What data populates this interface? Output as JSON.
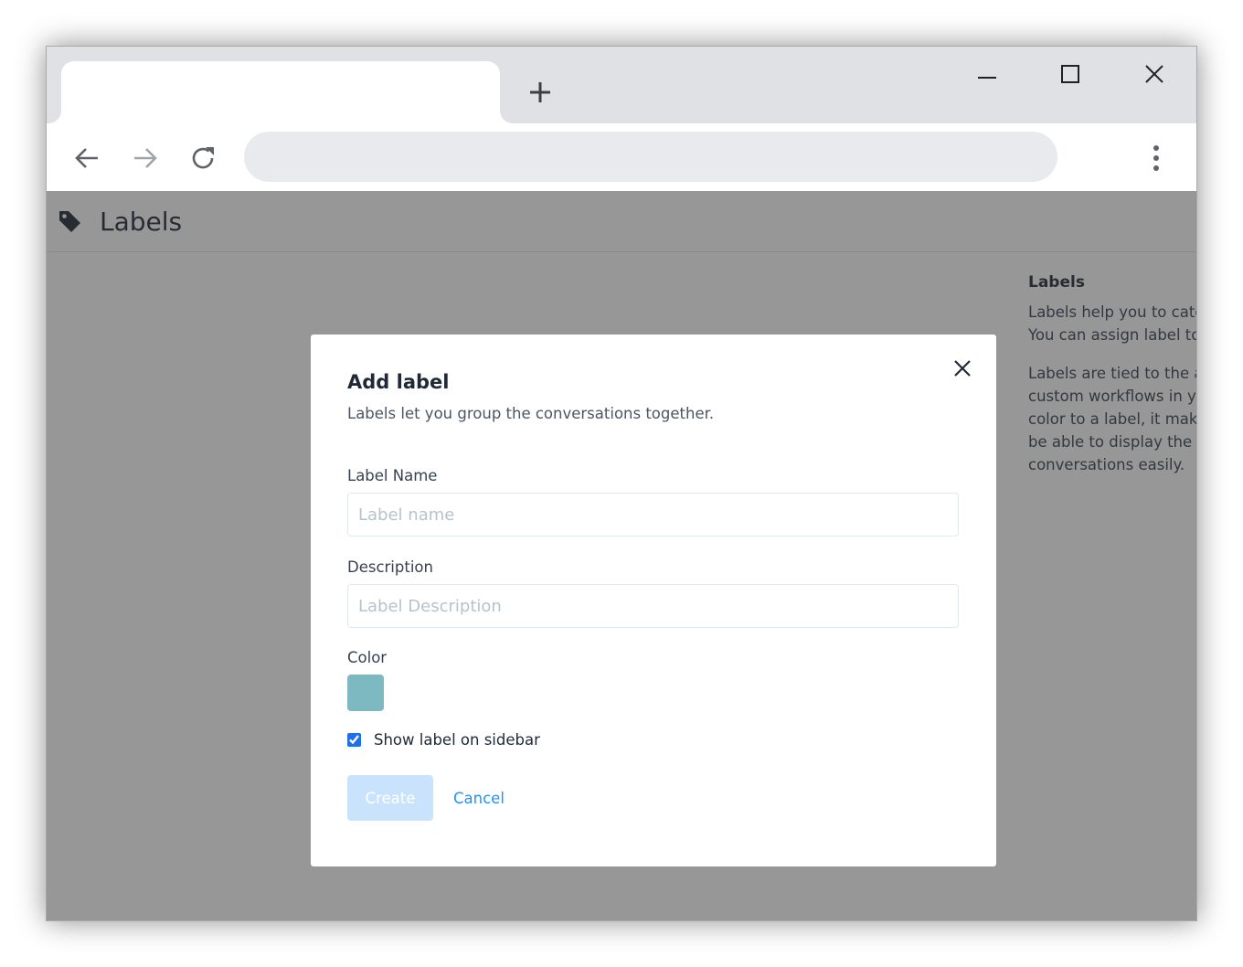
{
  "browser": {
    "tab_title": "",
    "address": "",
    "colors": {
      "tabstrip": "#dfe1e5",
      "omnibox": "#e8eaed"
    },
    "icons": [
      "plus-icon",
      "minimize-icon",
      "maximize-icon",
      "close-icon",
      "arrow-left-icon",
      "arrow-right-icon",
      "reload-icon",
      "kebab-menu-icon"
    ]
  },
  "page": {
    "title": "Labels",
    "title_icon": "tag-icon",
    "side_info": {
      "heading": "Labels",
      "para1_line1": "Labels help you to cate",
      "para1_line2": "You can assign label to",
      "para2_line1": "Labels are tied to the a",
      "para2_line2": "custom workflows in y",
      "para2_line3": "color to a label, it make",
      "para2_line4": "be able to display the l",
      "para2_line5": "conversations easily."
    }
  },
  "modal": {
    "title": "Add label",
    "subtitle": "Labels let you group the conversations together.",
    "label_name": {
      "label": "Label Name",
      "placeholder": "Label name",
      "value": ""
    },
    "description": {
      "label": "Description",
      "placeholder": "Label Description",
      "value": ""
    },
    "color": {
      "label": "Color",
      "value": "#7cb9c0"
    },
    "show_on_sidebar": {
      "label": "Show label on sidebar",
      "checked": true
    },
    "create_label": "Create",
    "cancel_label": "Cancel",
    "colors": {
      "create_bg": "#c9e3fc",
      "cancel_text": "#1f93ff"
    }
  }
}
